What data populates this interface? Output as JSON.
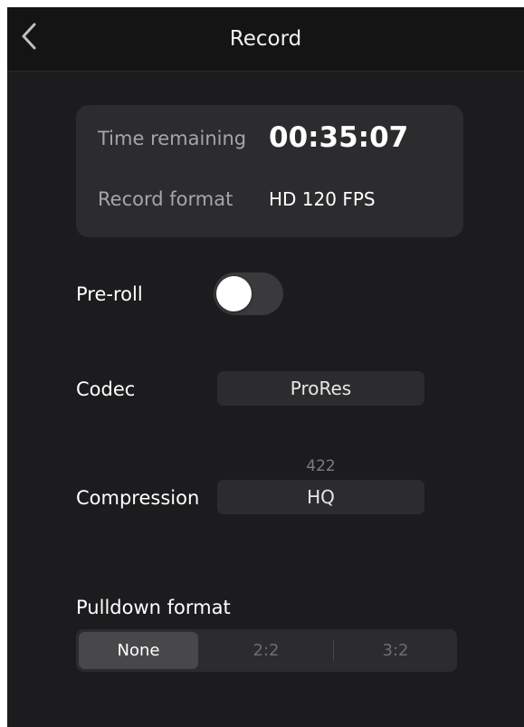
{
  "navbar": {
    "title": "Record",
    "back_icon": "chevron-left-icon"
  },
  "info": {
    "time_remaining_label": "Time remaining",
    "time_remaining_value": "00:35:07",
    "record_format_label": "Record format",
    "record_format_value": "HD 120 FPS"
  },
  "preroll": {
    "label": "Pre-roll",
    "enabled": false
  },
  "codec": {
    "label": "Codec",
    "value": "ProRes"
  },
  "compression": {
    "label": "Compression",
    "value_above": "422",
    "value": "HQ"
  },
  "pulldown": {
    "label": "Pulldown format",
    "options": [
      "None",
      "2:2",
      "3:2"
    ],
    "selected": "None"
  }
}
